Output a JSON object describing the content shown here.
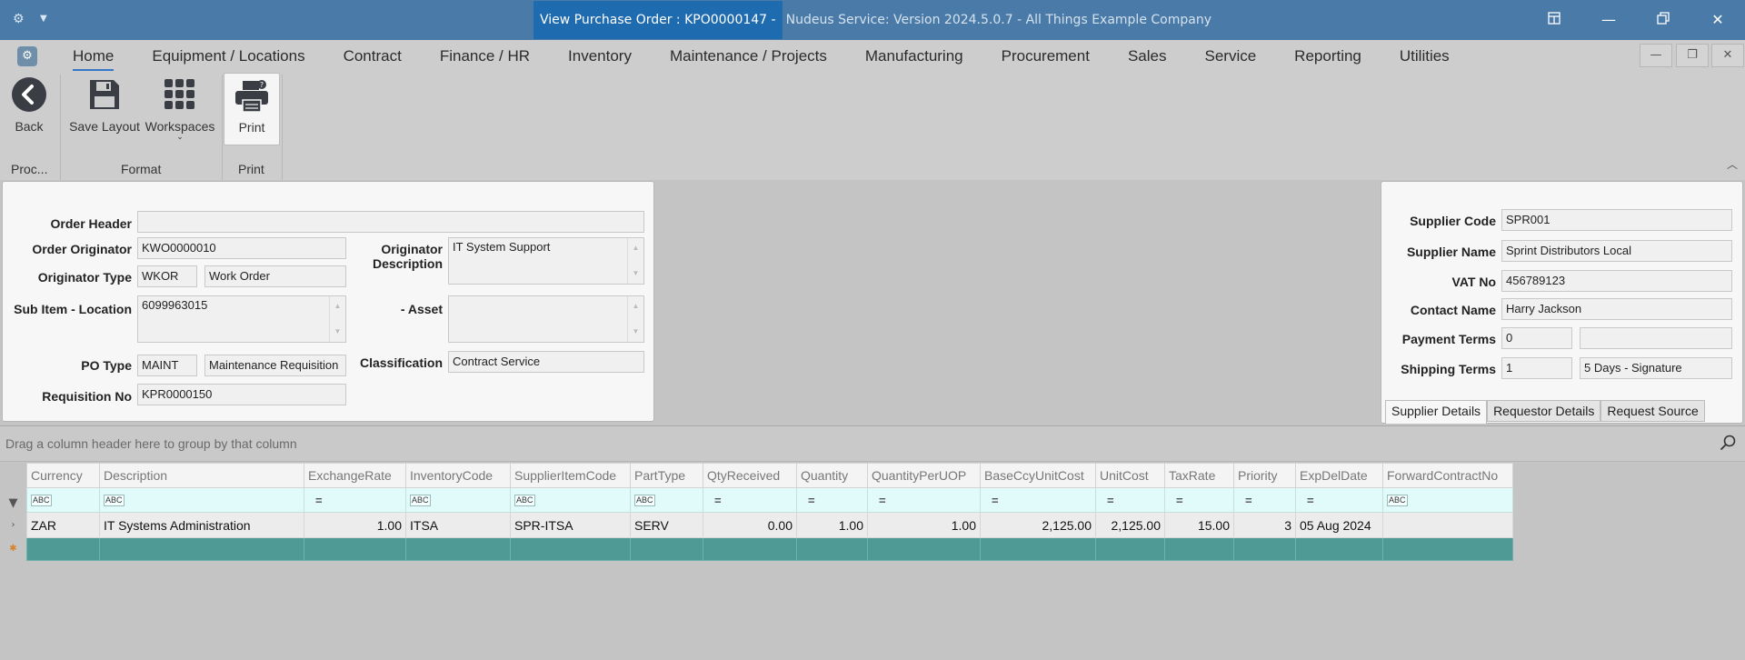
{
  "titlebar": {
    "active_title": "View Purchase Order : KPO0000147 -",
    "rest_title": "Nudeus Service: Version 2024.5.0.7 - All Things Example Company",
    "icons": [
      "gear-icon",
      "chevron-down-icon",
      "layout-icon",
      "minimize-icon",
      "restore-icon",
      "close-icon"
    ]
  },
  "ribbon": {
    "menu_tabs": [
      "Home",
      "Equipment / Locations",
      "Contract",
      "Finance / HR",
      "Inventory",
      "Maintenance / Projects",
      "Manufacturing",
      "Procurement",
      "Sales",
      "Service",
      "Reporting",
      "Utilities"
    ],
    "active_tab": "Home",
    "buttons": {
      "back": "Back",
      "save_layout": "Save Layout",
      "workspaces": "Workspaces",
      "print": "Print"
    },
    "groups": {
      "process": "Proc...",
      "format": "Format",
      "print": "Print"
    }
  },
  "order_panel": {
    "order_header_label": "Order Header",
    "order_header_value": "",
    "order_originator_label": "Order Originator",
    "order_originator_value": "KWO0000010",
    "originator_description_label_1": "Originator",
    "originator_description_label_2": "Description",
    "originator_description_value": "IT System Support",
    "originator_type_label": "Originator Type",
    "originator_type_code": "WKOR",
    "originator_type_name": "Work Order",
    "sub_item_location_label": "Sub Item - Location",
    "sub_item_location_value": "6099963015",
    "asset_label": "- Asset",
    "asset_value": "",
    "po_type_label": "PO Type",
    "po_type_code": "MAINT",
    "po_type_name": "Maintenance Requisition",
    "classification_label": "Classification",
    "classification_value": "Contract Service",
    "requisition_no_label": "Requisition No",
    "requisition_no_value": "KPR0000150"
  },
  "supplier_panel": {
    "supplier_code_label": "Supplier Code",
    "supplier_code_value": "SPR001",
    "supplier_name_label": "Supplier Name",
    "supplier_name_value": "Sprint Distributors Local",
    "vat_no_label": "VAT No",
    "vat_no_value": "456789123",
    "contact_name_label": "Contact Name",
    "contact_name_value": "Harry Jackson",
    "payment_terms_label": "Payment Terms",
    "payment_terms_code": "0",
    "payment_terms_desc": "",
    "shipping_terms_label": "Shipping Terms",
    "shipping_terms_code": "1",
    "shipping_terms_desc": "5 Days - Signature",
    "tabs": [
      "Supplier Details",
      "Requestor Details",
      "Request Source"
    ],
    "active_tab": "Supplier Details"
  },
  "grid": {
    "group_hint": "Drag a column header here to group by that column",
    "filter_abc": "ABC",
    "filter_eq": "=",
    "columns": [
      "Currency",
      "Description",
      "ExchangeRate",
      "InventoryCode",
      "SupplierItemCode",
      "PartType",
      "QtyReceived",
      "Quantity",
      "QuantityPerUOP",
      "BaseCcyUnitCost",
      "UnitCost",
      "TaxRate",
      "Priority",
      "ExpDelDate",
      "ForwardContractNo"
    ],
    "rows": [
      [
        "ZAR",
        "IT Systems Administration",
        "1.00",
        "ITSA",
        "SPR-ITSA",
        "SERV",
        "0.00",
        "1.00",
        "1.00",
        "2,125.00",
        "2,125.00",
        "15.00",
        "3",
        "05 Aug 2024",
        ""
      ]
    ]
  },
  "colors": {
    "titlebar": "#4a7ba8",
    "title_active": "#1f6bb0",
    "filter_row": "#e1fafa",
    "new_row": "#4f9a94"
  }
}
